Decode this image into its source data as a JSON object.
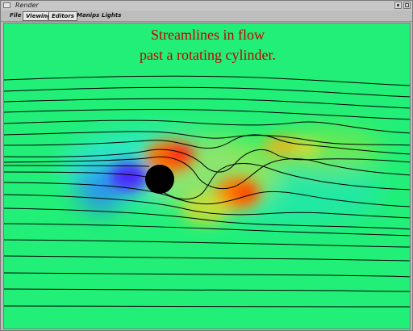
{
  "window": {
    "title": "Render"
  },
  "menubar": {
    "items": [
      {
        "label": "File"
      },
      {
        "label": "Viewing"
      },
      {
        "label": "Editors"
      },
      {
        "label": "Manips"
      },
      {
        "label": "Lights"
      }
    ]
  },
  "render": {
    "title_line_1": "Streamlines in flow",
    "title_line_2": "past a rotating cylinder.",
    "colors": {
      "background": "#22ef78",
      "title_text": "#c30000",
      "cylinder": "#000000",
      "streamlines": "#000000"
    }
  }
}
